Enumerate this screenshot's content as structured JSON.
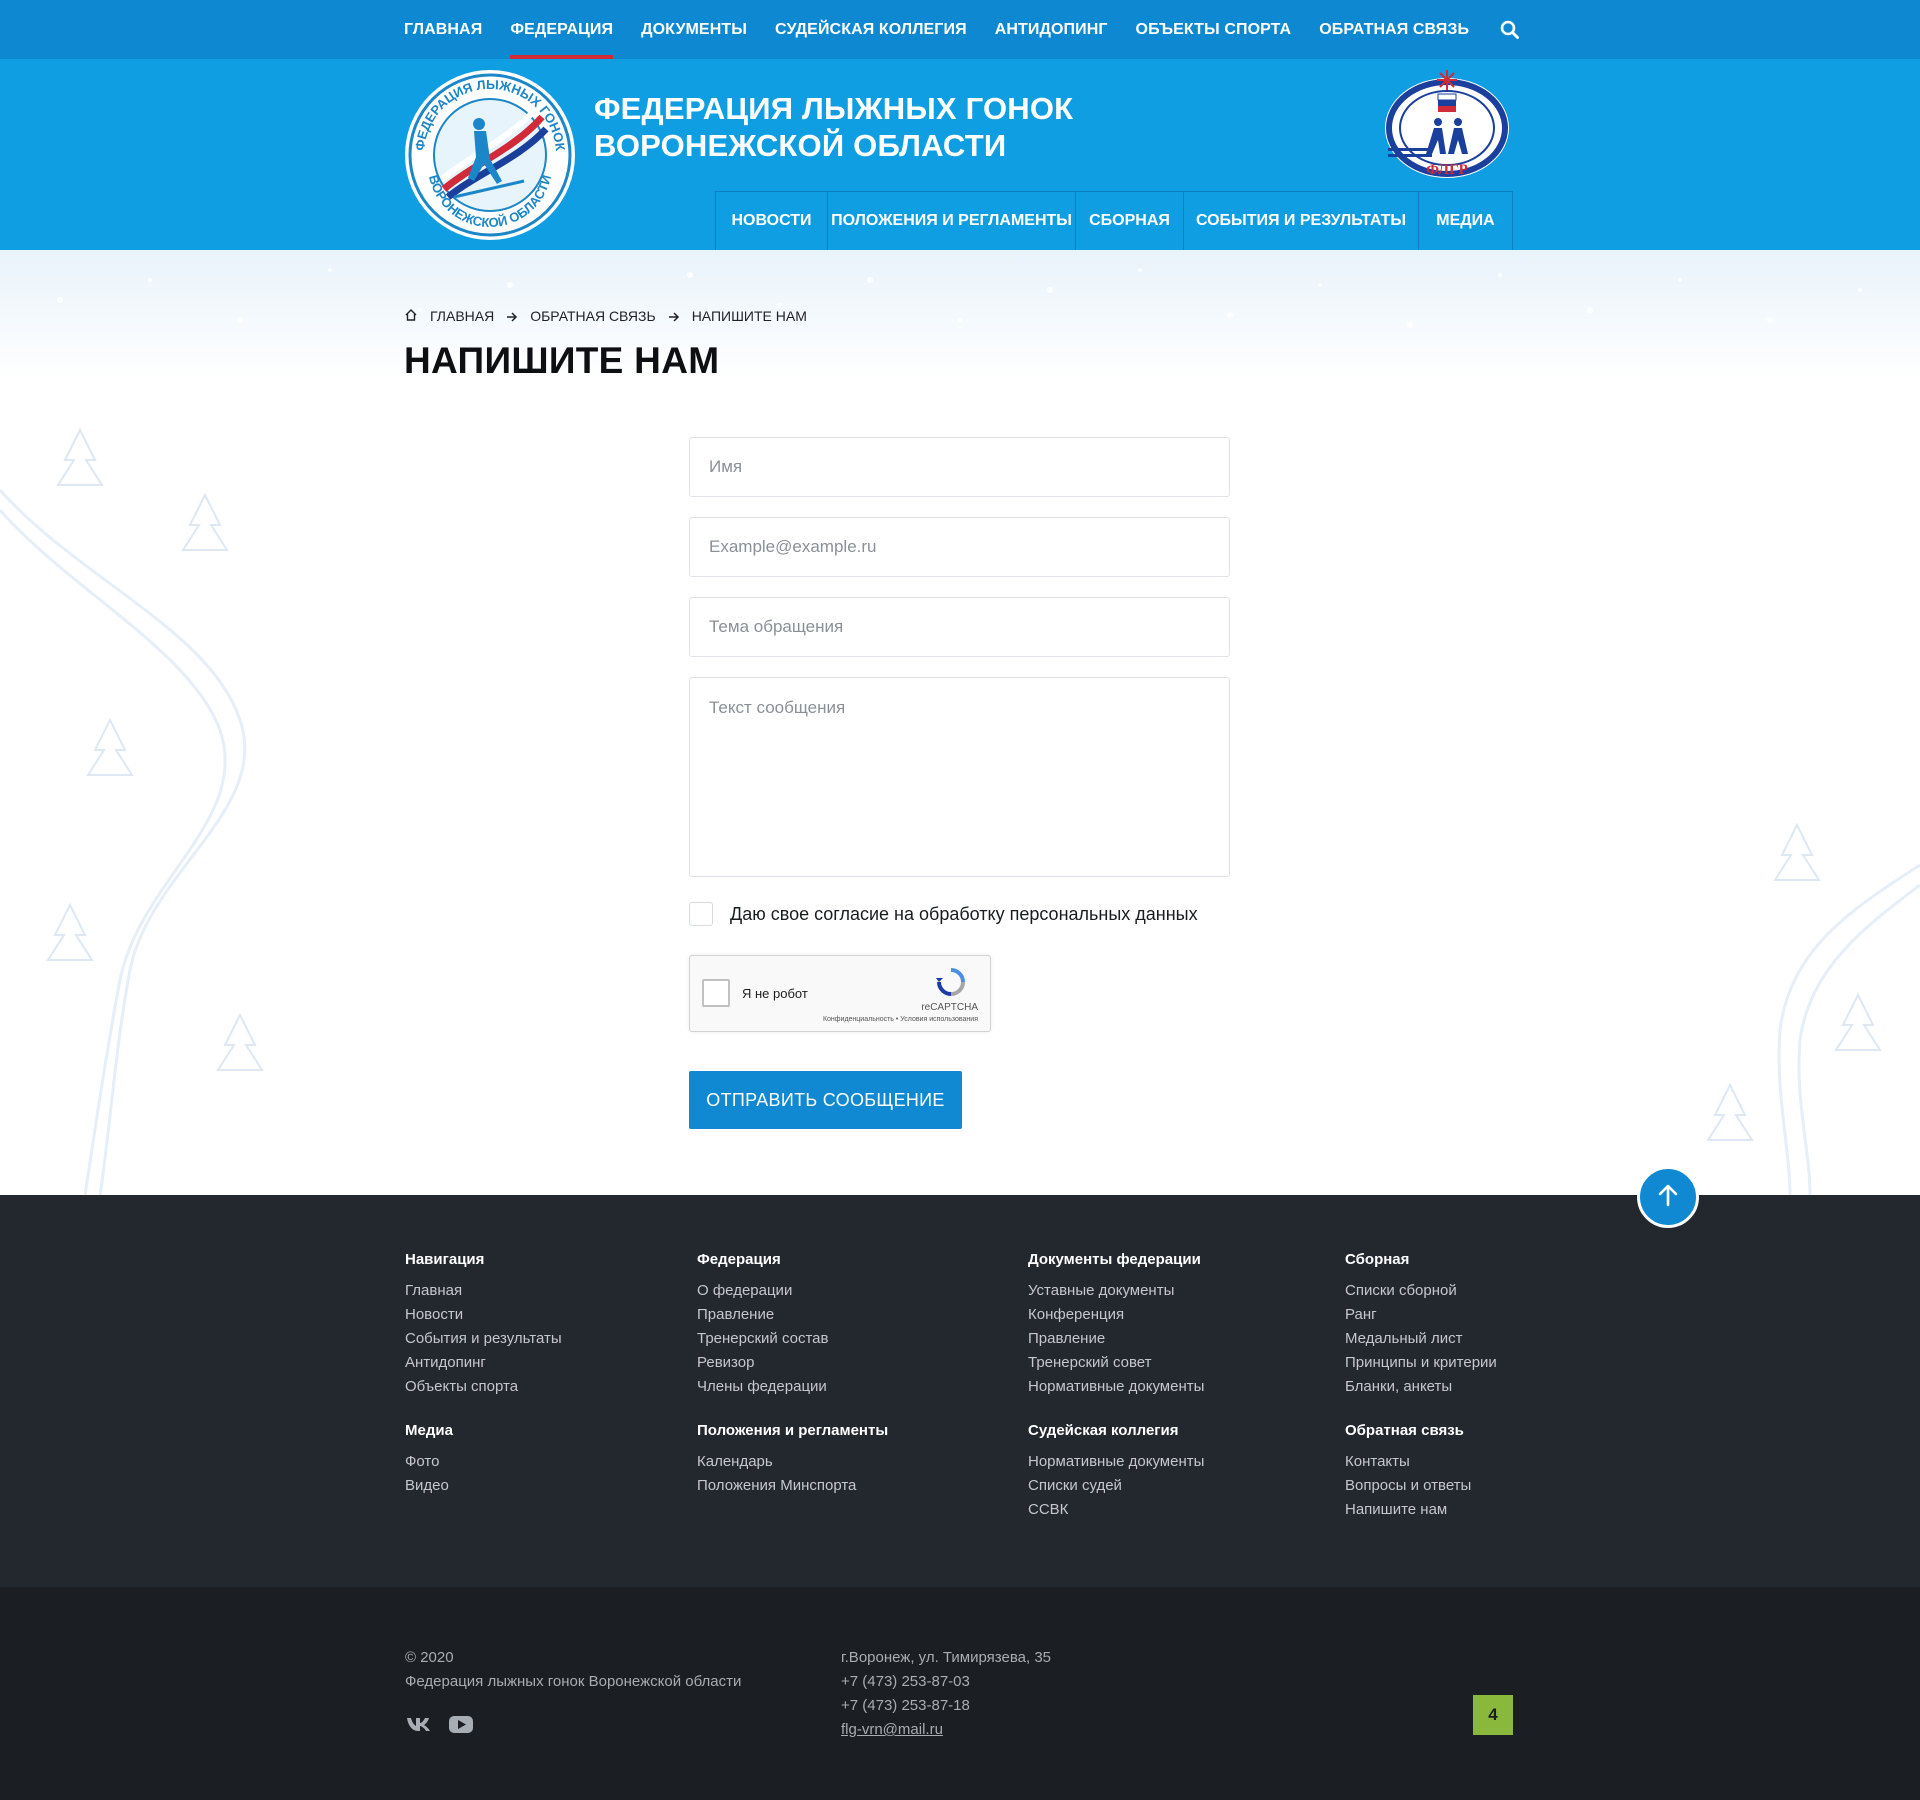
{
  "topnav": {
    "items": [
      "ГЛАВНАЯ",
      "ФЕДЕРАЦИЯ",
      "ДОКУМЕНТЫ",
      "СУДЕЙСКАЯ КОЛЛЕГИЯ",
      "АНТИДОПИНГ",
      "ОБЪЕКТЫ СПОРТА",
      "ОБРАТНАЯ СВЯЗЬ"
    ],
    "active_item": "ФЕДЕРАЦИЯ",
    "search_icon": "search-icon"
  },
  "header": {
    "title_line1": "ФЕДЕРАЦИЯ ЛЫЖНЫХ ГОНОК",
    "title_line2": "ВОРОНЕЖСКОЙ ОБЛАСТИ",
    "logo_ring_text": "ФЕДЕРАЦИЯ ЛЫЖНЫХ ГОНОК • ВОРОНЕЖСКОЙ ОБЛАСТИ",
    "partner_logo_text": "ФЛГР",
    "subnav": [
      "НОВОСТИ",
      "ПОЛОЖЕНИЯ И РЕГЛАМЕНТЫ",
      "СБОРНАЯ",
      "СОБЫТИЯ И РЕЗУЛЬТАТЫ",
      "МЕДИА"
    ]
  },
  "breadcrumb": {
    "home": "ГЛАВНАЯ",
    "section": "ОБРАТНАЯ СВЯЗЬ",
    "current": "НАПИШИТЕ НАМ"
  },
  "page_title": "НАПИШИТЕ НАМ",
  "form": {
    "name_placeholder": "Имя",
    "email_placeholder": "Example@example.ru",
    "subject_placeholder": "Тема обращения",
    "message_placeholder": "Текст сообщения",
    "consent_label": "Даю свое согласие на обработку персональных данных",
    "captcha_label": "Я не робот",
    "captcha_brand": "reCAPTCHA",
    "captcha_terms": "Конфиденциальность • Условия использования",
    "submit_label": "ОТПРАВИТЬ СООБЩЕНИЕ"
  },
  "footer": {
    "columns": [
      {
        "heading": "Навигация",
        "links": [
          "Главная",
          "Новости",
          "События и результаты",
          "Антидопинг",
          "Объекты спорта"
        ]
      },
      {
        "heading": "Федерация",
        "links": [
          "О федерации",
          "Правление",
          "Тренерский состав",
          "Ревизор",
          "Члены федерации"
        ]
      },
      {
        "heading": "Документы федерации",
        "links": [
          "Уставные документы",
          "Конференция",
          "Правление",
          "Тренерский совет",
          "Нормативные документы"
        ]
      },
      {
        "heading": "Сборная",
        "links": [
          "Списки сборной",
          "Ранг",
          "Медальный лист",
          "Принципы и критерии",
          "Бланки, анкеты"
        ]
      },
      {
        "heading": "Медиа",
        "links": [
          "Фото",
          "Видео"
        ]
      },
      {
        "heading": "Положения и регламенты",
        "links": [
          "Календарь",
          "Положения Минспорта"
        ]
      },
      {
        "heading": "Судейская коллегия",
        "links": [
          "Нормативные документы",
          "Списки судей",
          "ССВК"
        ]
      },
      {
        "heading": "Обратная связь",
        "links": [
          "Контакты",
          "Вопросы и ответы",
          "Напишите нам"
        ]
      }
    ],
    "copyright_year": "© 2020",
    "copyright_org": "Федерация лыжных гонок Воронежской области",
    "address": "г.Воронеж, ул. Тимирязева, 35",
    "phone1": "+7 (473) 253-87-03",
    "phone2": "+7 (473) 253-87-18",
    "email": "flg-vrn@mail.ru",
    "counter": "4"
  },
  "colors": {
    "topbar": "#0e88d0",
    "header": "#109ee3",
    "accent_red": "#d12b3a",
    "button": "#1089d2",
    "footer": "#23272e",
    "footer_bottom": "#1b1e22",
    "counter": "#8ab83c"
  }
}
